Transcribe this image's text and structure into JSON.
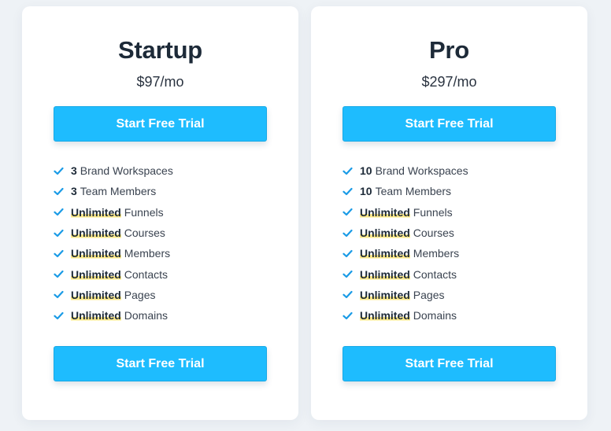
{
  "plans": [
    {
      "name": "Startup",
      "price": "$97/mo",
      "cta_top": "Start Free Trial",
      "cta_bottom": "Start Free Trial",
      "features": [
        {
          "amount": "3",
          "label": "Brand Workspaces",
          "highlight": false
        },
        {
          "amount": "3",
          "label": "Team Members",
          "highlight": false
        },
        {
          "amount": "Unlimited",
          "label": "Funnels",
          "highlight": true
        },
        {
          "amount": "Unlimited",
          "label": "Courses",
          "highlight": true
        },
        {
          "amount": "Unlimited",
          "label": "Members",
          "highlight": true
        },
        {
          "amount": "Unlimited",
          "label": "Contacts",
          "highlight": true
        },
        {
          "amount": "Unlimited",
          "label": "Pages",
          "highlight": true
        },
        {
          "amount": "Unlimited",
          "label": "Domains",
          "highlight": true
        }
      ]
    },
    {
      "name": "Pro",
      "price": "$297/mo",
      "cta_top": "Start Free Trial",
      "cta_bottom": "Start Free Trial",
      "features": [
        {
          "amount": "10",
          "label": "Brand Workspaces",
          "highlight": false
        },
        {
          "amount": "10",
          "label": "Team Members",
          "highlight": false
        },
        {
          "amount": "Unlimited",
          "label": "Funnels",
          "highlight": true
        },
        {
          "amount": "Unlimited",
          "label": "Courses",
          "highlight": true
        },
        {
          "amount": "Unlimited",
          "label": "Members",
          "highlight": true
        },
        {
          "amount": "Unlimited",
          "label": "Contacts",
          "highlight": true
        },
        {
          "amount": "Unlimited",
          "label": "Pages",
          "highlight": true
        },
        {
          "amount": "Unlimited",
          "label": "Domains",
          "highlight": true
        }
      ]
    }
  ],
  "colors": {
    "accent": "#1ebcfe",
    "check": "#1a9be6",
    "highlight": "#fde98a",
    "title": "#1d2a38"
  },
  "icons": {
    "feature_check": "check-icon"
  }
}
